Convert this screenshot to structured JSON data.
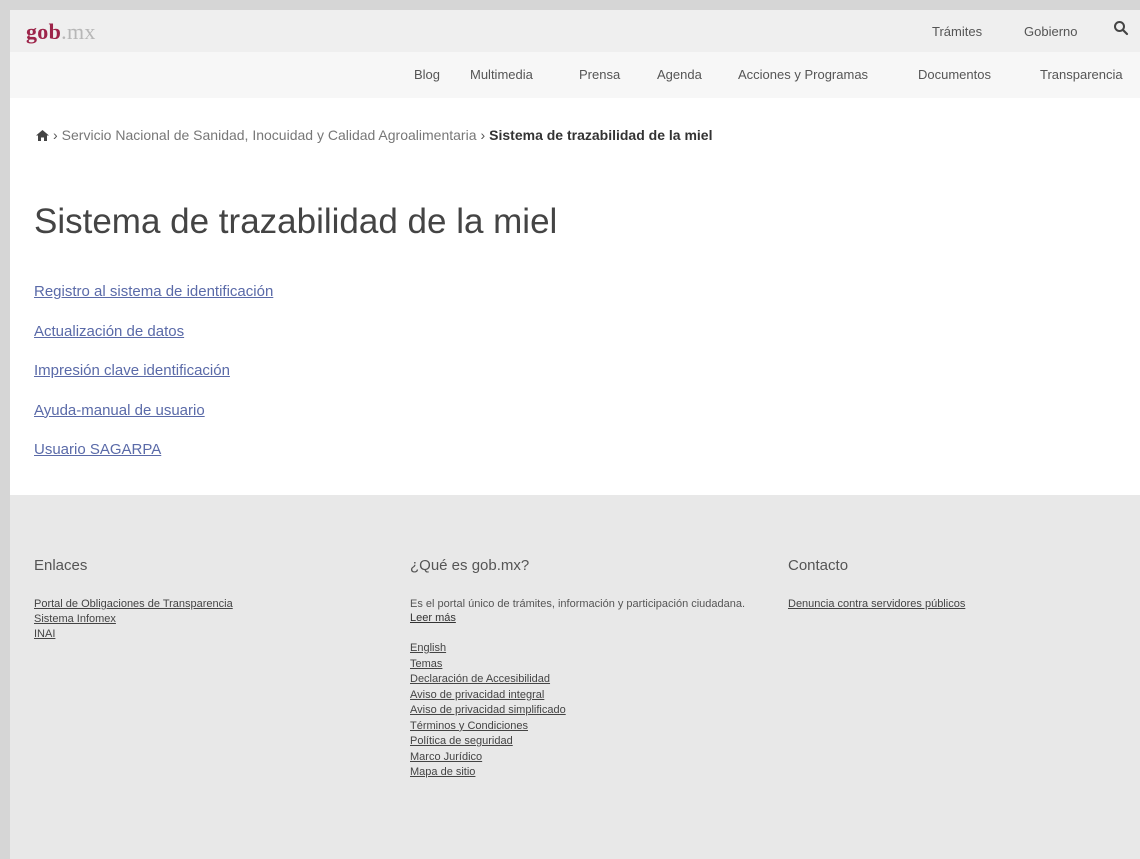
{
  "logo": {
    "part1": "gob",
    "part2": ".mx"
  },
  "top_nav": [
    "Trámites",
    "Gobierno"
  ],
  "sub_nav": [
    "Blog",
    "Multimedia",
    "Prensa",
    "Agenda",
    "Acciones y Programas",
    "Documentos",
    "Transparencia"
  ],
  "breadcrumb": {
    "home_icon": "home-icon",
    "parent": "Servicio Nacional de Sanidad, Inocuidad y Calidad Agroalimentaria",
    "current": "Sistema de trazabilidad de la miel",
    "separator": "›"
  },
  "title": "Sistema de trazabilidad de la miel",
  "links": [
    "Registro al sistema de identificación",
    "Actualización de datos",
    "Impresión clave identificación",
    "Ayuda-manual de usuario",
    "Usuario SAGARPA"
  ],
  "footer": {
    "enlaces": {
      "heading": "Enlaces",
      "links": [
        "Portal de Obligaciones de Transparencia",
        "Sistema Infomex",
        "INAI"
      ]
    },
    "about": {
      "heading": "¿Qué es gob.mx?",
      "text": "Es el portal único de trámites, información y participación ciudadana.",
      "more": "Leer más",
      "links": [
        "English",
        "Temas",
        "Declaración de Accesibilidad",
        "Aviso de privacidad integral",
        "Aviso de privacidad simplificado",
        "Términos y Condiciones",
        "Política de seguridad",
        "Marco Jurídico",
        "Mapa de sitio"
      ]
    },
    "contacto": {
      "heading": "Contacto",
      "links": [
        "Denuncia contra servidores públicos"
      ]
    }
  },
  "colors": {
    "brand": "#9d2449",
    "link": "#5a6aa8",
    "footer_bg": "#e8e8e8"
  }
}
